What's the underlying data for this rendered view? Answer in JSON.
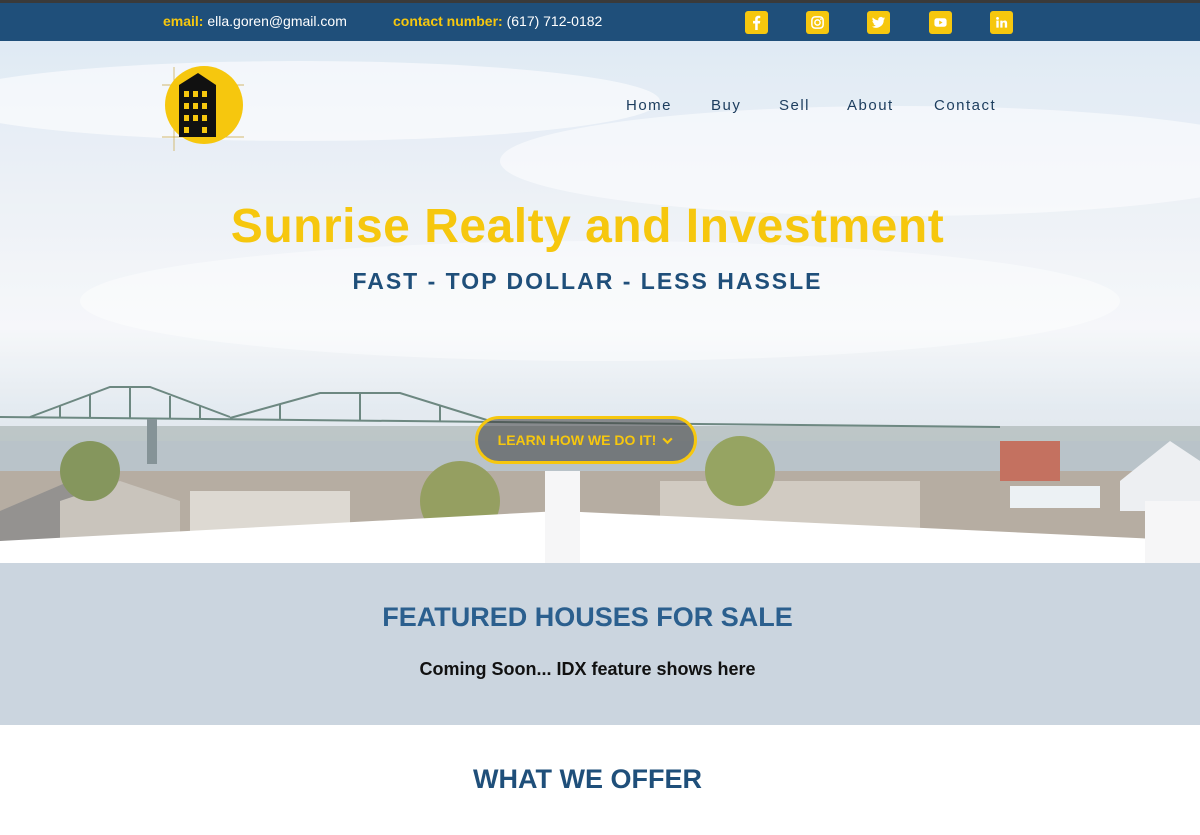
{
  "topbar": {
    "email_label": "email:",
    "email_value": "ella.goren@gmail.com",
    "phone_label": "contact number:",
    "phone_value": "(617) 712-0182",
    "social": [
      "facebook-icon",
      "instagram-icon",
      "twitter-icon",
      "youtube-icon",
      "linkedin-icon"
    ]
  },
  "nav": {
    "items": [
      "Home",
      "Buy",
      "Sell",
      "About",
      "Contact"
    ]
  },
  "hero": {
    "title": "Sunrise Realty and Investment",
    "subtitle": "FAST - TOP DOLLAR - LESS HASSLE",
    "cta_label": "LEARN HOW WE DO IT!",
    "cta_icon": "chevron-down-icon"
  },
  "featured": {
    "title": "FEATURED HOUSES FOR SALE",
    "note": "Coming Soon... IDX feature shows here"
  },
  "offer": {
    "title": "WHAT WE OFFER"
  },
  "colors": {
    "navy": "#1f4f7a",
    "accent_yellow": "#f6c70e",
    "featured_bg": "#cbd5df"
  }
}
